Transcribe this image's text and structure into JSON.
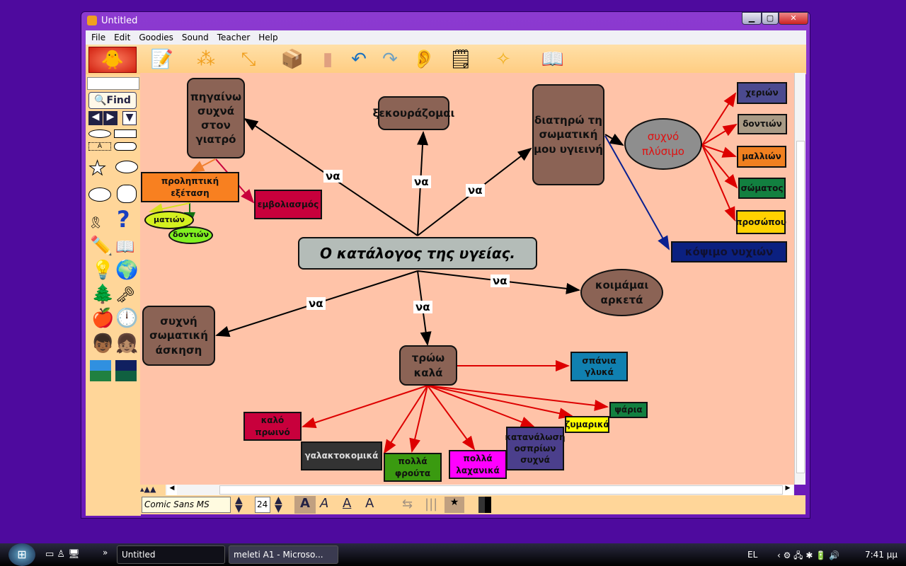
{
  "window": {
    "title": "Untitled",
    "min": "▁",
    "max": "▢",
    "close": "✕"
  },
  "menu": [
    "File",
    "Edit",
    "Goodies",
    "Sound",
    "Teacher",
    "Help"
  ],
  "toolbar": {
    "icons": [
      "draw-idea-icon",
      "add-node-icon",
      "link-tool-icon",
      "symbols-box-icon",
      "eraser-icon",
      "undo-icon",
      "redo-icon",
      "listen-ear-icon",
      "name-label-icon",
      "paint-sparkle-icon",
      "dictionary-icon"
    ]
  },
  "leftbar": {
    "find_label": "Find",
    "search_value": "",
    "shape_text_label": "A"
  },
  "map": {
    "center": "Ο κατάλογος  της υγείας.",
    "link_label": "να",
    "doctor": "πηγαίνω συχνά στον γιατρό",
    "rest": "ξεκουράζομαι",
    "hygiene": "διατηρώ τη σωματική μου υγιεινή",
    "washing": "συχνό πλύσιμο",
    "hands": "χεριών",
    "teeth1": "δοντιών",
    "hair": "μαλλιών",
    "body": "σώματος",
    "face": "προσώπου",
    "nails": "κόψιμο   νυχιών",
    "sleep": "κοιμάμαι αρκετά",
    "exercise": "συχνή σωματική άσκηση",
    "eat": "τρώω καλά",
    "sweets": "σπάνια γλυκά",
    "checkup": "προληπτική εξέταση",
    "vaccine": "εμβολιασμός",
    "eyes": "ματιών",
    "teeth2": "δοντιών",
    "breakfast": "καλό πρωινό",
    "dairy": "γαλακτοκομικά",
    "fruit": "πολλά φρούτα",
    "veg": "πολλά λαχανικά",
    "legumes": "κατανάλωση οσπρίων συχνά",
    "pasta": "ζυμαρικά",
    "fish": "ψάρια"
  },
  "bottombar": {
    "font": "Comic Sans MS",
    "size": "24"
  },
  "taskbar": {
    "tasks": [
      "Untitled",
      "meleti A1 - Microso..."
    ],
    "lang": "EL",
    "time": "7:41 μμ"
  },
  "colors": {
    "desktop": "#4e0a9e",
    "canvas": "#ffc3a8",
    "node_brown": "#8b6355",
    "arrow_red": "#dd0000"
  }
}
